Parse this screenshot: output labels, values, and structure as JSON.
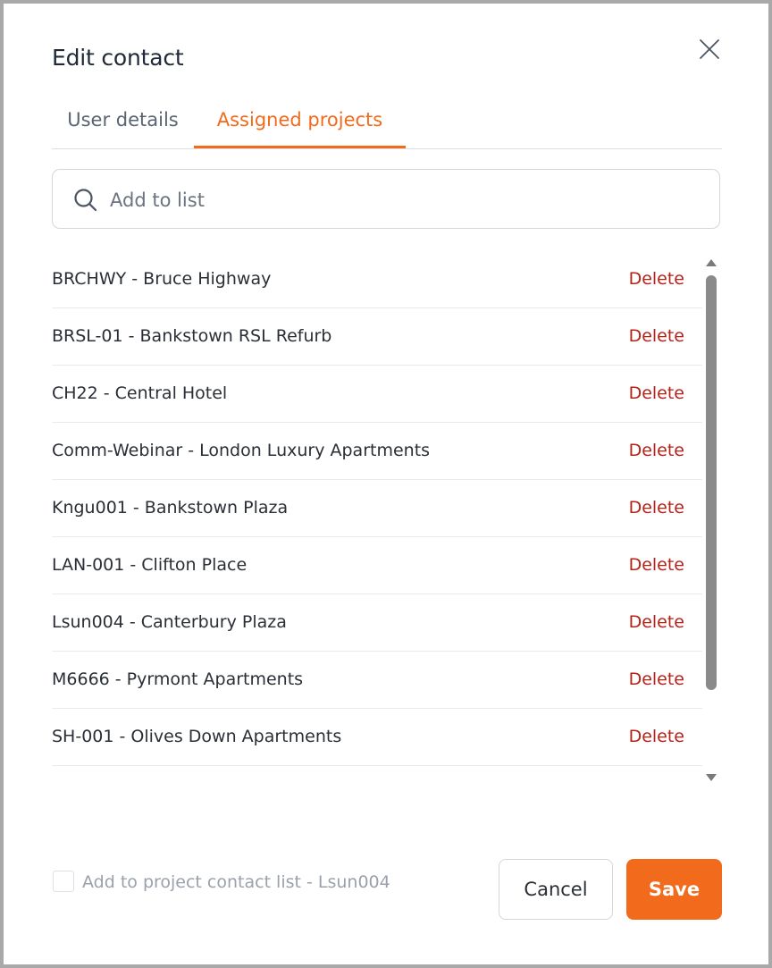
{
  "dialog": {
    "title": "Edit contact",
    "close_icon": "close-icon"
  },
  "tabs": [
    {
      "label": "User details",
      "active": false
    },
    {
      "label": "Assigned projects",
      "active": true
    }
  ],
  "search": {
    "placeholder": "Add to list",
    "value": "",
    "icon": "search-icon"
  },
  "projects": [
    {
      "label": "BRCHWY - Bruce Highway",
      "action": "Delete"
    },
    {
      "label": "BRSL-01 - Bankstown RSL Refurb",
      "action": "Delete"
    },
    {
      "label": "CH22 - Central Hotel",
      "action": "Delete"
    },
    {
      "label": "Comm-Webinar - London Luxury Apartments",
      "action": "Delete"
    },
    {
      "label": "Kngu001 - Bankstown Plaza",
      "action": "Delete"
    },
    {
      "label": "LAN-001 - Clifton Place",
      "action": "Delete"
    },
    {
      "label": "Lsun004 - Canterbury Plaza",
      "action": "Delete"
    },
    {
      "label": "M6666 - Pyrmont Apartments",
      "action": "Delete"
    },
    {
      "label": "SH-001 - Olives Down Apartments",
      "action": "Delete"
    }
  ],
  "footer": {
    "checkbox_label": "Add to project contact list - Lsun004",
    "checkbox_checked": false,
    "cancel_label": "Cancel",
    "save_label": "Save"
  },
  "colors": {
    "accent": "#f26a1b",
    "delete": "#b42318"
  }
}
